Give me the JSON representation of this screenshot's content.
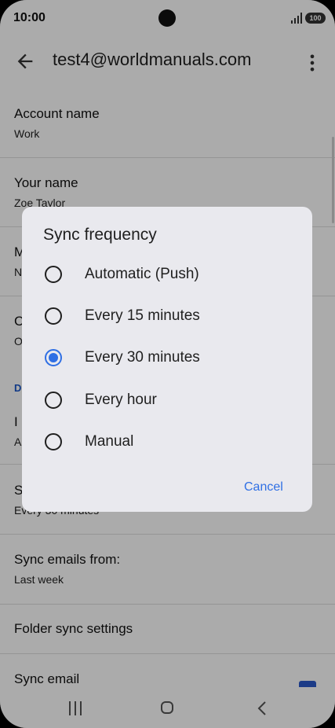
{
  "status": {
    "time": "10:00",
    "battery": "100"
  },
  "header": {
    "title": "test4@worldmanuals.com"
  },
  "settings": {
    "account_name": {
      "label": "Account name",
      "value": "Work"
    },
    "your_name": {
      "label": "Your name",
      "value": "Zoe Taylor"
    },
    "row_m": {
      "label": "M",
      "value": "N"
    },
    "row_c": {
      "label": "C",
      "value": "O"
    },
    "section_d": "D",
    "row_i": {
      "label": "I",
      "value": "A"
    },
    "row_s": {
      "label": "S",
      "value": "Every 30 minutes"
    },
    "sync_emails_from": {
      "label": "Sync emails from:",
      "value": "Last week"
    },
    "folder_sync": {
      "label": "Folder sync settings"
    },
    "sync_email": {
      "label": "Sync email"
    }
  },
  "dialog": {
    "title": "Sync frequency",
    "options": [
      {
        "label": "Automatic (Push)",
        "selected": false
      },
      {
        "label": "Every 15 minutes",
        "selected": false
      },
      {
        "label": "Every 30 minutes",
        "selected": true
      },
      {
        "label": "Every hour",
        "selected": false
      },
      {
        "label": "Manual",
        "selected": false
      }
    ],
    "cancel_label": "Cancel"
  },
  "colors": {
    "accent": "#2f6fe4",
    "section": "#1a57c8",
    "scrim": "rgba(0,0,0,0.33)"
  },
  "icons": {
    "back": "arrow-back-icon",
    "more": "more-vert-icon",
    "home": "home-icon",
    "recents": "recents-icon",
    "nav_back": "chevron-left-icon"
  }
}
